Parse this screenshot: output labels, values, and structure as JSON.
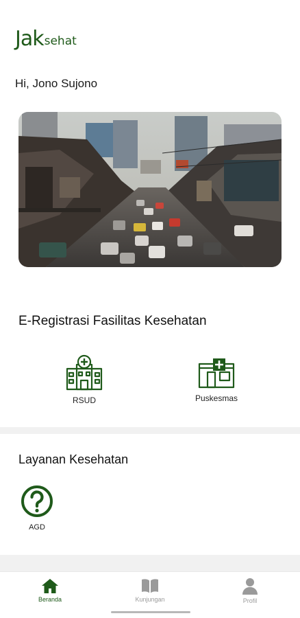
{
  "brand": {
    "prefix": "Jak",
    "suffix": "sehat",
    "color": "#1f5a1a"
  },
  "greeting": "Hi, Jono Sujono",
  "banner": {
    "alt": ""
  },
  "registration": {
    "title": "E-Registrasi Fasilitas Kesehatan",
    "items": [
      {
        "label": "RSUD",
        "icon": "hospital-icon"
      },
      {
        "label": "Puskesmas",
        "icon": "clinic-icon"
      }
    ]
  },
  "services": {
    "title": "Layanan Kesehatan",
    "items": [
      {
        "label": "AGD",
        "icon": "question-circle-icon"
      }
    ]
  },
  "nav": {
    "items": [
      {
        "label": "Beranda",
        "icon": "home-icon",
        "active": true,
        "color": "#1f5a1a"
      },
      {
        "label": "Kunjungan",
        "icon": "book-icon",
        "active": false,
        "color": "#9a9a9a"
      },
      {
        "label": "Profil",
        "icon": "user-icon",
        "active": false,
        "color": "#9a9a9a"
      }
    ]
  }
}
